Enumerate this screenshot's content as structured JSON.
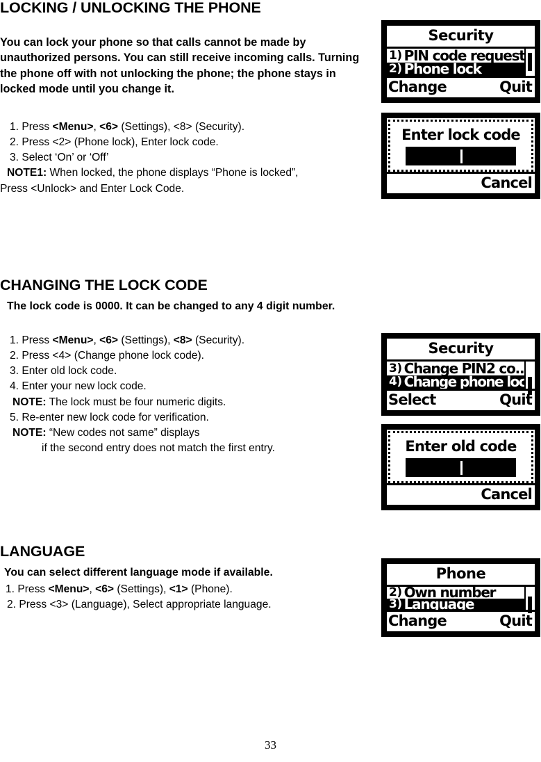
{
  "page": {
    "number": "33"
  },
  "sections": [
    {
      "heading": "LOCKING / UNLOCKING THE PHONE",
      "intro": "You can lock your phone so that calls cannot be made by unauthorized persons. You can still receive incoming calls. Turning the phone off with not unlocking the phone; the phone stays in locked mode until you change it.",
      "steps": [
        {
          "parts": [
            {
              "t": "1. Press ",
              "b": false
            },
            {
              "t": "<Menu>",
              "b": true
            },
            {
              "t": ", ",
              "b": false
            },
            {
              "t": "<6>",
              "b": true
            },
            {
              "t": " (Settings), <8> (Security).",
              "b": false
            }
          ]
        },
        {
          "parts": [
            {
              "t": "2. Press <2> (Phone lock), Enter lock code.",
              "b": false
            }
          ]
        },
        {
          "parts": [
            {
              "t": "3. Select ‘On’ or ‘Off’",
              "b": false
            }
          ]
        },
        {
          "parts": [
            {
              "t": "NOTE1:",
              "b": true
            },
            {
              "t": " When locked, the phone displays “Phone is locked”,",
              "b": false
            }
          ]
        },
        {
          "parts": [
            {
              "t": "Press <Unlock> and Enter Lock Code.",
              "b": false
            }
          ]
        }
      ]
    },
    {
      "heading": "CHANGING THE LOCK CODE",
      "subtitle": "The lock code is 0000. It can be changed to any 4 digit number.",
      "steps": [
        {
          "parts": [
            {
              "t": "1. Press ",
              "b": false
            },
            {
              "t": "<Menu>",
              "b": true
            },
            {
              "t": ", ",
              "b": false
            },
            {
              "t": "<6>",
              "b": true
            },
            {
              "t": " (Settings), ",
              "b": false
            },
            {
              "t": "<8>",
              "b": true
            },
            {
              "t": " (Security).",
              "b": false
            }
          ]
        },
        {
          "parts": [
            {
              "t": "2. Press <4> (Change phone lock code).",
              "b": false
            }
          ]
        },
        {
          "parts": [
            {
              "t": "3. Enter old lock code.",
              "b": false
            }
          ]
        },
        {
          "parts": [
            {
              "t": "4. Enter your new lock code.",
              "b": false
            }
          ]
        },
        {
          "parts": [
            {
              "t": "NOTE:",
              "b": true
            },
            {
              "t": " The lock must be four numeric digits.",
              "b": false
            }
          ]
        },
        {
          "parts": [
            {
              "t": "5. Re-enter new lock code for verification.",
              "b": false
            }
          ]
        },
        {
          "parts": [
            {
              "t": "NOTE:",
              "b": true
            },
            {
              "t": " “New codes not same” displays",
              "b": false
            }
          ]
        },
        {
          "parts": [
            {
              "t": "if the second entry does not  match the first entry.",
              "b": false
            }
          ]
        }
      ]
    },
    {
      "heading": "LANGUAGE",
      "subtitle": "You can select different language mode if available.",
      "steps": [
        {
          "parts": [
            {
              "t": "1. Press ",
              "b": false
            },
            {
              "t": "<Menu>",
              "b": true
            },
            {
              "t": ", ",
              "b": false
            },
            {
              "t": "<6>",
              "b": true
            },
            {
              "t": " (Settings), ",
              "b": false
            },
            {
              "t": "<1>",
              "b": true
            },
            {
              "t": " (Phone).",
              "b": false
            }
          ]
        },
        {
          "parts": [
            {
              "t": "2. Press <3> (Language), Select appropriate language.",
              "b": false
            }
          ]
        }
      ]
    }
  ],
  "screens": {
    "security_phone_lock": {
      "title": "Security",
      "rows": [
        {
          "num": "1)",
          "label": "PIN code request",
          "selected": false
        },
        {
          "num": "2)",
          "label": "Phone lock",
          "selected": true
        }
      ],
      "softkey_left": "Change",
      "softkey_right": "Quit"
    },
    "enter_lock_code": {
      "title": "Enter lock code",
      "value": "",
      "softkey_right": "Cancel"
    },
    "security_change_lock": {
      "title": "Security",
      "rows": [
        {
          "num": "3)",
          "label": "Change PIN2 co...",
          "selected": false
        },
        {
          "num": "4)",
          "label": "Change phone lock",
          "selected": true
        }
      ],
      "softkey_left": "Select",
      "softkey_right": "Quit"
    },
    "enter_old_code": {
      "title": "Enter old code",
      "value": "",
      "softkey_right": "Cancel"
    },
    "phone_language": {
      "title": "Phone",
      "rows": [
        {
          "num": "2)",
          "label": "Own number",
          "selected": false
        },
        {
          "num": "3)",
          "label": "Language",
          "selected": true
        }
      ],
      "softkey_left": "Change",
      "softkey_right": "Quit"
    }
  }
}
